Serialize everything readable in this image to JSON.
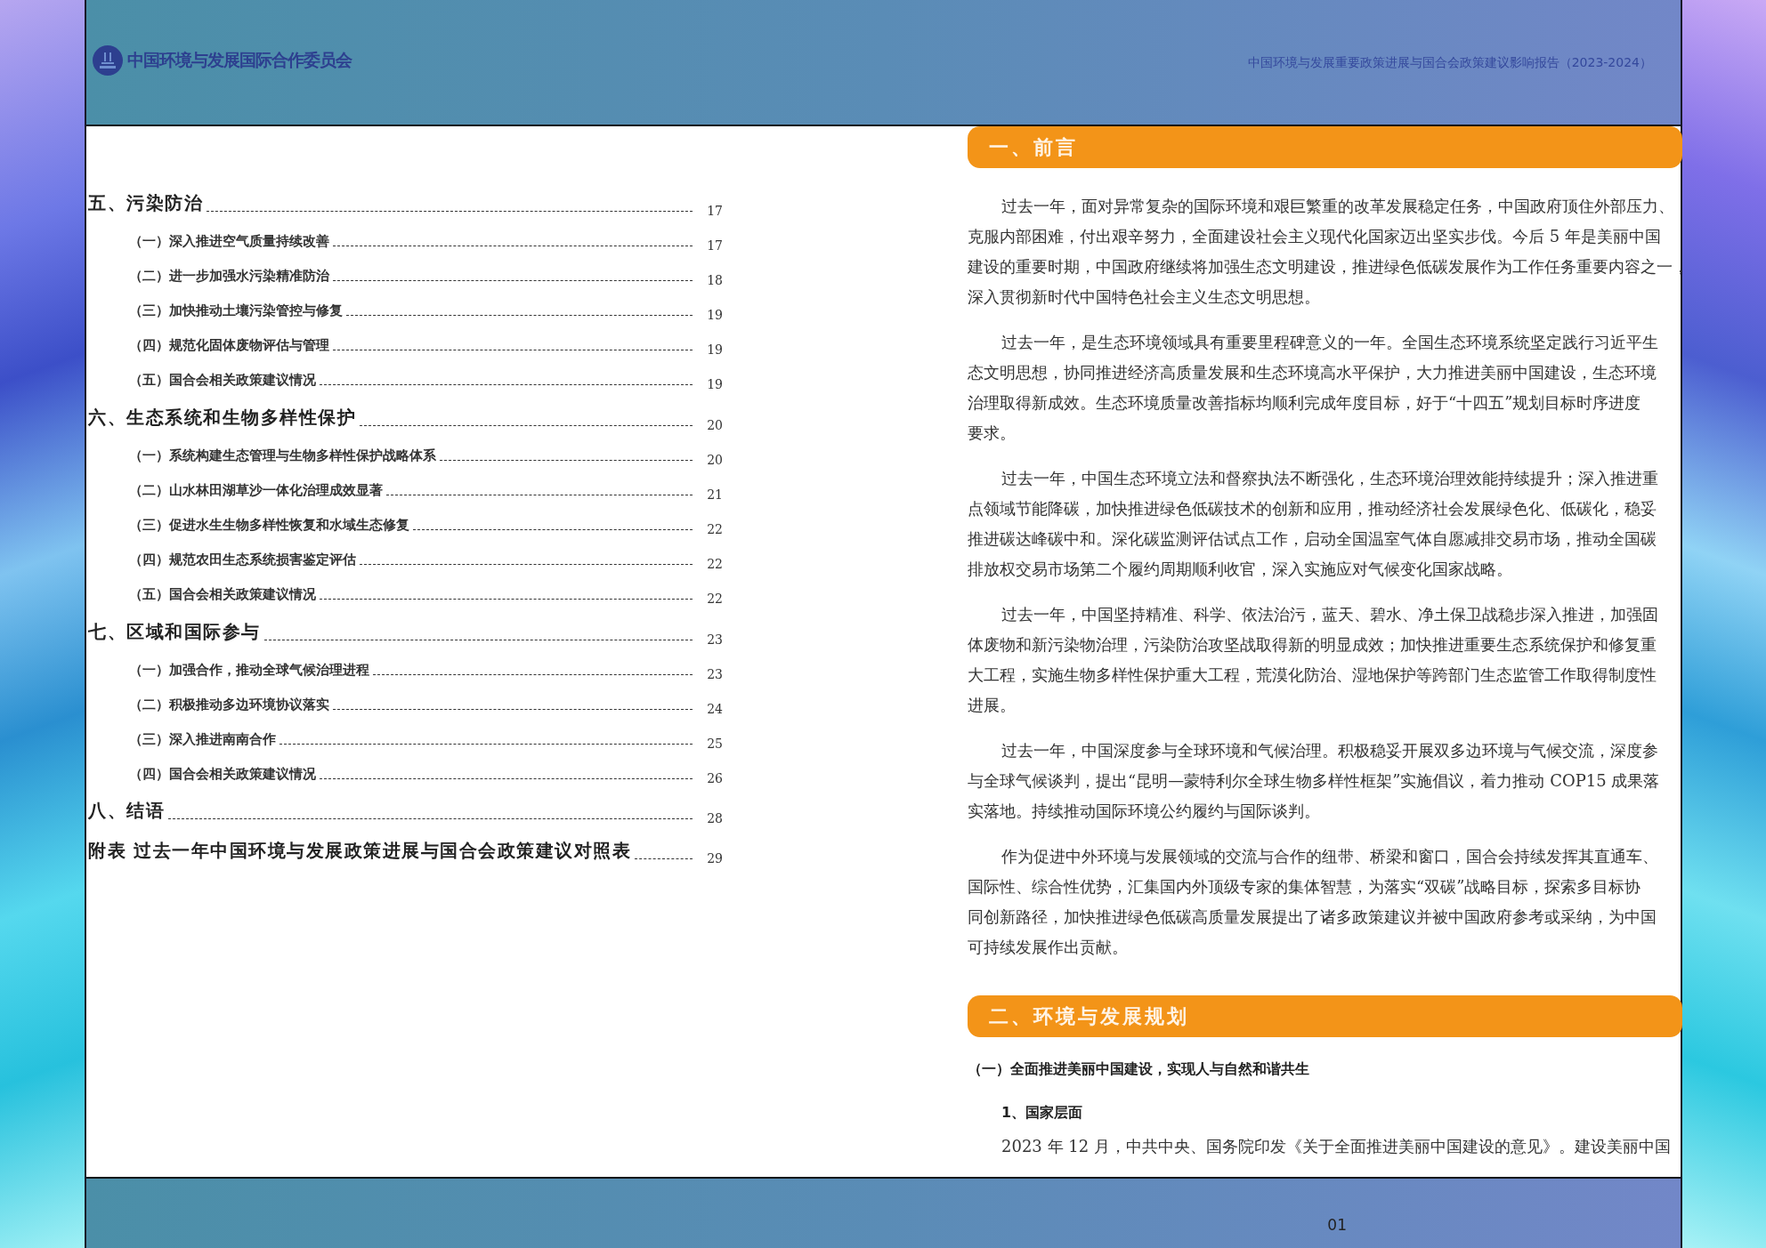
{
  "header": {
    "org_name": "中国环境与发展国际合作委员会",
    "report_title": "中国环境与发展重要政策进展与国合会政策建议影响报告（2023-2024）"
  },
  "toc": [
    {
      "title": "五、污染防治",
      "page": "17",
      "children": [
        {
          "title": "（一）深入推进空气质量持续改善",
          "page": "17"
        },
        {
          "title": "（二）进一步加强水污染精准防治",
          "page": "18"
        },
        {
          "title": "（三）加快推动土壤污染管控与修复",
          "page": "19"
        },
        {
          "title": "（四）规范化固体废物评估与管理",
          "page": "19"
        },
        {
          "title": "（五）国合会相关政策建议情况",
          "page": "19"
        }
      ]
    },
    {
      "title": "六、生态系统和生物多样性保护",
      "page": "20",
      "children": [
        {
          "title": "（一）系统构建生态管理与生物多样性保护战略体系",
          "page": "20"
        },
        {
          "title": "（二）山水林田湖草沙一体化治理成效显著",
          "page": "21"
        },
        {
          "title": "（三）促进水生生物多样性恢复和水域生态修复",
          "page": "22"
        },
        {
          "title": "（四）规范农田生态系统损害鉴定评估",
          "page": "22"
        },
        {
          "title": "（五）国合会相关政策建议情况",
          "page": "22"
        }
      ]
    },
    {
      "title": "七、区域和国际参与",
      "page": "23",
      "children": [
        {
          "title": "（一）加强合作，推动全球气候治理进程",
          "page": "23"
        },
        {
          "title": "（二）积极推动多边环境协议落实",
          "page": "24"
        },
        {
          "title": "（三）深入推进南南合作",
          "page": "25"
        },
        {
          "title": "（四）国合会相关政策建议情况",
          "page": "26"
        }
      ]
    },
    {
      "title": "八、结语",
      "page": "28"
    },
    {
      "title": "附表 过去一年中国环境与发展政策进展与国合会政策建议对照表",
      "page": "29"
    }
  ],
  "content": [
    {
      "kind": "banner",
      "text": "一、前言"
    },
    {
      "kind": "paragraph",
      "lines": [
        "过去一年，面对异常复杂的国际环境和艰巨繁重的改革发展稳定任务，中国政府顶住外部压力、",
        "克服内部困难，付出艰辛努力，全面建设社会主义现代化国家迈出坚实步伐。今后 5 年是美丽中国",
        "建设的重要时期，中国政府继续将加强生态文明建设，推进绿色低碳发展作为工作任务重要内容之一，",
        "深入贯彻新时代中国特色社会主义生态文明思想。"
      ]
    },
    {
      "kind": "paragraph",
      "lines": [
        "过去一年，是生态环境领域具有重要里程碑意义的一年。全国生态环境系统坚定践行习近平生",
        "态文明思想，协同推进经济高质量发展和生态环境高水平保护，大力推进美丽中国建设，生态环境",
        "治理取得新成效。生态环境质量改善指标均顺利完成年度目标，好于“十四五”规划目标时序进度",
        "要求。"
      ]
    },
    {
      "kind": "paragraph",
      "lines": [
        "过去一年，中国生态环境立法和督察执法不断强化，生态环境治理效能持续提升；深入推进重",
        "点领域节能降碳，加快推进绿色低碳技术的创新和应用，推动经济社会发展绿色化、低碳化，稳妥",
        "推进碳达峰碳中和。深化碳监测评估试点工作，启动全国温室气体自愿减排交易市场，推动全国碳",
        "排放权交易市场第二个履约周期顺利收官，深入实施应对气候变化国家战略。"
      ]
    },
    {
      "kind": "paragraph",
      "lines": [
        "过去一年，中国坚持精准、科学、依法治污，蓝天、碧水、净土保卫战稳步深入推进，加强固",
        "体废物和新污染物治理，污染防治攻坚战取得新的明显成效；加快推进重要生态系统保护和修复重",
        "大工程，实施生物多样性保护重大工程，荒漠化防治、湿地保护等跨部门生态监管工作取得制度性",
        "进展。"
      ]
    },
    {
      "kind": "paragraph",
      "lines": [
        "过去一年，中国深度参与全球环境和气候治理。积极稳妥开展双多边环境与气候交流，深度参",
        "与全球气候谈判，提出“昆明—蒙特利尔全球生物多样性框架”实施倡议，着力推动 COP15 成果落",
        "实落地。持续推动国际环境公约履约与国际谈判。"
      ]
    },
    {
      "kind": "paragraph",
      "lines": [
        "作为促进中外环境与发展领域的交流与合作的纽带、桥梁和窗口，国合会持续发挥其直通车、",
        "国际性、综合性优势，汇集国内外顶级专家的集体智慧，为落实“双碳”战略目标，探索多目标协",
        "同创新路径，加快推进绿色低碳高质量发展提出了诸多政策建议并被中国政府参考或采纳，为中国",
        "可持续发展作出贡献。"
      ]
    },
    {
      "kind": "banner",
      "text": "二、环境与发展规划"
    },
    {
      "kind": "subheading",
      "text": "（一）全面推进美丽中国建设，实现人与自然和谐共生"
    },
    {
      "kind": "minor_heading",
      "text": "1、国家层面"
    },
    {
      "kind": "paragraph",
      "lines": [
        "2023 年 12 月，中共中央、国务院印发《关于全面推进美丽中国建设的意见》。建设美丽中国"
      ]
    }
  ],
  "footer": {
    "page_number": "01"
  }
}
